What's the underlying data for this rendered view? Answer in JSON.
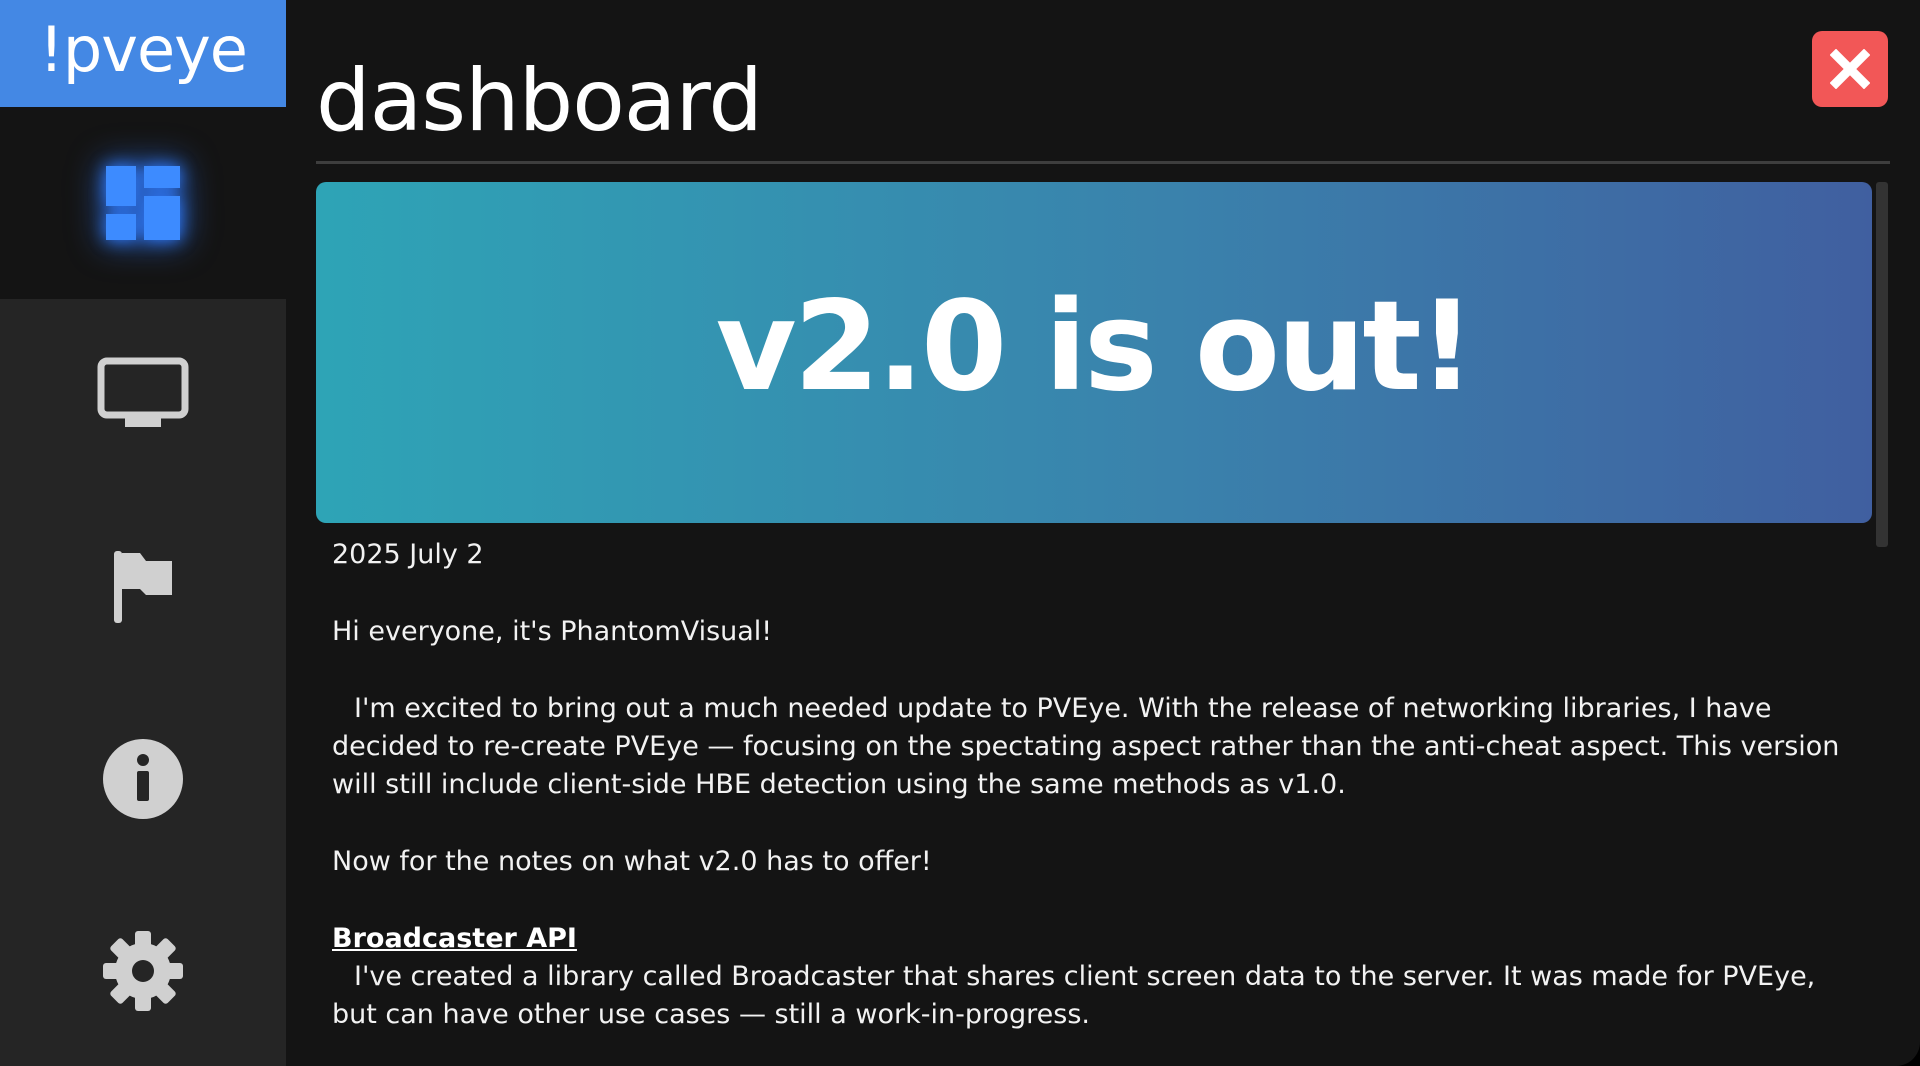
{
  "app": {
    "logo_text": "!pveye"
  },
  "sidebar": {
    "items": [
      {
        "icon": "dashboard-icon",
        "active": true
      },
      {
        "icon": "monitor-icon",
        "active": false
      },
      {
        "icon": "flag-icon",
        "active": false
      },
      {
        "icon": "info-icon",
        "active": false
      },
      {
        "icon": "gear-icon",
        "active": false
      }
    ]
  },
  "header": {
    "title": "dashboard",
    "close_icon": "close-icon"
  },
  "colors": {
    "accent": "#4488e4",
    "close": "#f25757",
    "banner_start": "#2ea4b6",
    "banner_end": "#405fa0"
  },
  "post": {
    "banner_title": "v2.0 is out!",
    "date": "2025 July 2",
    "greeting": "Hi everyone, it's PhantomVisual!",
    "intro": "I'm excited to bring out a much needed update to PVEye. With the release of networking libraries, I have decided to re-create PVEye — focusing on the spectating aspect rather than the anti-cheat aspect. This version will still include client-side HBE detection using the same methods as v1.0.",
    "notes_lead": "Now for the notes on what v2.0 has to offer!",
    "sections": [
      {
        "heading": "Broadcaster API",
        "body": "I've created a library called Broadcaster that shares client screen data to the server. It was made for PVEye, but can have other use cases — still a work-in-progress."
      }
    ]
  }
}
